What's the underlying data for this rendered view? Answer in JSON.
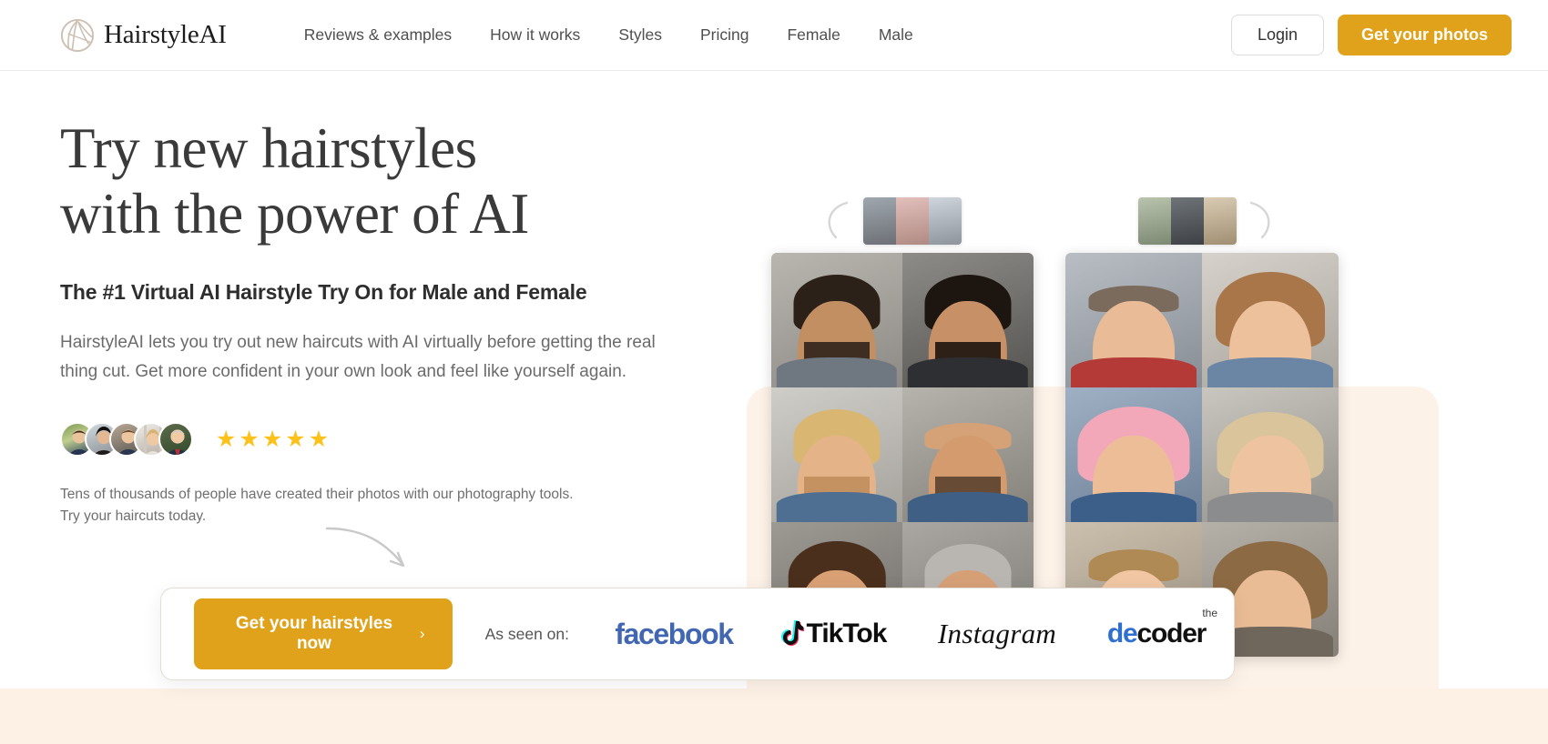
{
  "header": {
    "brand_name": "HairstyleAI",
    "logo_icon": "hairstyle-circle-logo",
    "nav": [
      {
        "label": "Reviews & examples"
      },
      {
        "label": "How it works"
      },
      {
        "label": "Styles"
      },
      {
        "label": "Pricing"
      },
      {
        "label": "Female"
      },
      {
        "label": "Male"
      }
    ],
    "login_label": "Login",
    "cta_label": "Get your photos"
  },
  "hero": {
    "headline_line1": "Try new hairstyles",
    "headline_line2": "with the power of AI",
    "subheadline": "The #1 Virtual AI Hairstyle Try On for Male and Female",
    "body": "HairstyleAI lets you try out new haircuts with AI virtually before getting the real thing cut. Get more confident in your own look and feel like yourself again.",
    "rating_stars": 5,
    "star_glyph": "★",
    "avatar_count": 5,
    "fineprint": "Tens of thousands of people have created their photos with our photography tools. Try your haircuts today."
  },
  "cta_bar": {
    "button_label": "Get your hairstyles now",
    "button_chevron": "›",
    "as_seen_label": "As seen on:",
    "logos": [
      {
        "name": "facebook",
        "text": "facebook"
      },
      {
        "name": "tiktok",
        "text": "TikTok"
      },
      {
        "name": "instagram",
        "text": "Instagram"
      },
      {
        "name": "the-decoder",
        "small": "the",
        "prefix": "de",
        "suffix": "coder"
      }
    ]
  },
  "colors": {
    "accent_amber": "#dfa21a",
    "star_yellow": "#fcc21b",
    "headline_gray": "#3a3a3a",
    "body_gray": "#6b6b6b",
    "peach_bg": "#fdf1e6",
    "facebook_blue": "#4267b2",
    "decoder_blue": "#2f6fd0"
  }
}
